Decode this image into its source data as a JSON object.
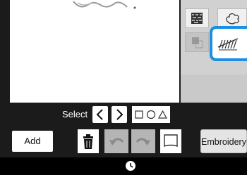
{
  "toolbar": {
    "select_label": "Select",
    "add_label": "Add",
    "embroidery_label": "Embroidery"
  },
  "icons": {
    "prev": "chevron-left-icon",
    "next": "chevron-right-icon",
    "shapes": "shape-select-icon",
    "delete": "trash-icon",
    "undo": "undo-icon",
    "redo": "redo-icon",
    "frame": "frame-icon",
    "clock": "clock-icon",
    "fill_stitch": "fill-stitch-icon",
    "outline": "outline-icon",
    "line_stitch": "line-stitch-icon",
    "move": "move-icon"
  },
  "colors": {
    "highlight": "#1a8fe3",
    "background": "#1b1b1b",
    "panel": "#d1d1d1"
  },
  "state": {
    "undo_enabled": false,
    "redo_enabled": false,
    "selected_tool": "line_stitch"
  }
}
